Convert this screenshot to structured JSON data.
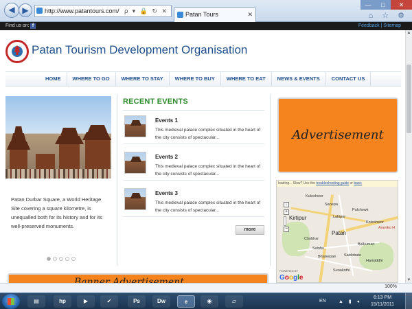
{
  "browser": {
    "address": "http://www.patantours.com/",
    "address_tools": "ρ ▾ 🔒 ↻ ✕",
    "tab_title": "Patan Tours",
    "tab_close": "✕",
    "window_controls": {
      "minimize": "—",
      "maximize": "□",
      "close": "✕"
    },
    "right_icons": "⌂ ☆ ⚙",
    "back_glyph": "◀",
    "forward_glyph": "▶",
    "zoom_level": "100%"
  },
  "topbar": {
    "find_us": "Find us on:",
    "facebook_glyph": "f",
    "links": "Feedback | Sitemap"
  },
  "header": {
    "title": "Patan Tourism Development Organisation"
  },
  "nav": {
    "items": [
      "HOME",
      "WHERE TO GO",
      "WHERE TO STAY",
      "WHERE TO BUY",
      "WHERE TO EAT",
      "NEWS & EVENTS",
      "CONTACT US"
    ]
  },
  "hero": {
    "caption": "Patan Durbar Square, a World Heritage Site covering a square kilometre, is unequalled both for its history and for its well-preserved monuments."
  },
  "events": {
    "heading": "RECENT EVENTS",
    "items": [
      {
        "title": "Events 1",
        "desc": "This medieval palace complex situated in the heart of the city consists of spectacular..."
      },
      {
        "title": "Events 2",
        "desc": "This medieval palace complex situated in the heart of the city consists of spectacular..."
      },
      {
        "title": "Events 3",
        "desc": "This medieval palace complex situated in the heart of the city consists of spectacular..."
      }
    ],
    "more_label": "more"
  },
  "ad": {
    "text": "Advertisement",
    "bottom_text": "Banner Advertisement"
  },
  "map": {
    "note_prefix": "loading... Slow? Use the ",
    "note_link1": "troubleshooting guide",
    "note_mid": " or ",
    "note_link2": "basic",
    "labels": {
      "kuleshwor": "Kuleshwor",
      "lalitpur": "Lalitpur",
      "kirtipur": "Kirtipur",
      "patan": "Patan",
      "bhaisepati": "Bhaisepati",
      "sainbu": "Sainbu",
      "satdobato": "Satdobato",
      "sunakothi": "Sunakothi",
      "kotesshwor": "Koteshwor",
      "ararilo": "Araniko H",
      "chobar": "Chobhar",
      "sanepa": "Sanepa",
      "pulchowk": "Pulchowk",
      "harisiddhi": "Harisiddhi",
      "balkumari": "Balkumari"
    },
    "powered": "POWERED BY",
    "google": [
      "G",
      "o",
      "o",
      "g",
      "l",
      "e"
    ]
  },
  "taskbar": {
    "lang": "EN",
    "time": "6:13 PM",
    "date": "15/11/2011",
    "apps": [
      {
        "name": "folder",
        "glyph": "▤"
      },
      {
        "name": "hp",
        "glyph": "hp"
      },
      {
        "name": "media",
        "glyph": "▶"
      },
      {
        "name": "tasks",
        "glyph": "✔"
      },
      {
        "name": "photoshop",
        "glyph": "Ps"
      },
      {
        "name": "dreamweaver",
        "glyph": "Dw"
      },
      {
        "name": "ie",
        "glyph": "e"
      },
      {
        "name": "firefox",
        "glyph": "◉"
      },
      {
        "name": "notes",
        "glyph": "▱"
      }
    ]
  }
}
